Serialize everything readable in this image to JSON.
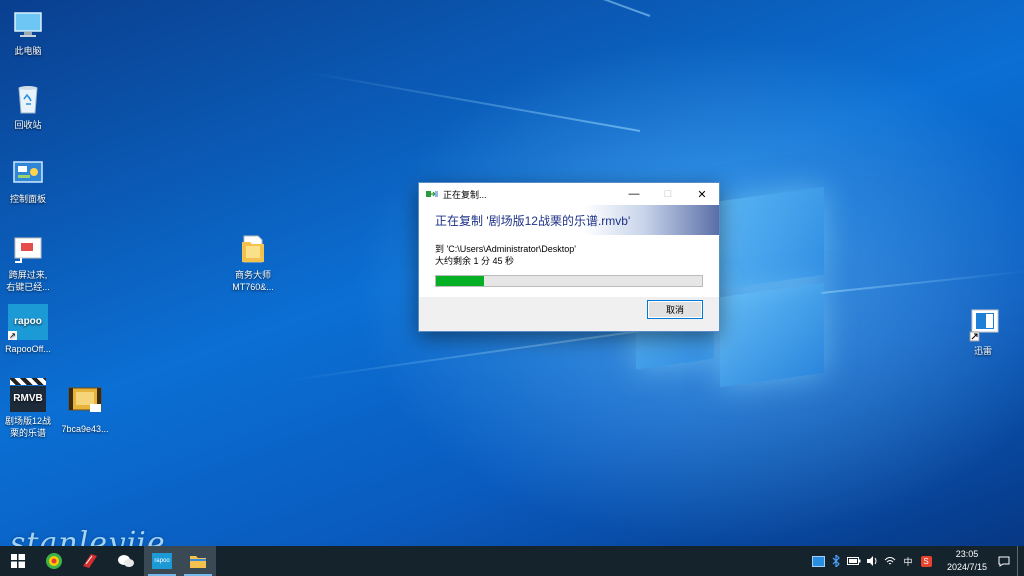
{
  "desktop": {
    "icons": [
      {
        "label": "此电脑"
      },
      {
        "label": "回收站"
      },
      {
        "label": "控制面板"
      },
      {
        "label": "跨屏过来,\n右键已经..."
      },
      {
        "label": "RapooOff..."
      },
      {
        "label": "剧场版12战\n栗的乐谱"
      },
      {
        "label": "7bca9e43..."
      },
      {
        "label": "商务大师\nMT760&..."
      },
      {
        "label": "迅雷"
      }
    ],
    "rapoo_logo_text": "rapoo",
    "rmvb_logo_text": "RMVB"
  },
  "dialog": {
    "title": "正在复制...",
    "heading": "正在复制 '剧场版12战栗的乐谱.rmvb'",
    "destination": "到 'C:\\Users\\Administrator\\Desktop'",
    "remaining": "大约剩余 1 分 45 秒",
    "progress_fraction": 0.18,
    "cancel_label": "取消",
    "minimize": "—",
    "maximize": "□",
    "close": "✕"
  },
  "watermark": "stanleyjie",
  "taskbar": {
    "ime_label": "中",
    "clock_time": "23:05",
    "clock_date": "2024/7/15",
    "rapoo_label": "rapoo"
  },
  "colors": {
    "progress_fill": "#06b025",
    "header_text": "#1e3287",
    "taskbar_bg": "#15232d"
  }
}
